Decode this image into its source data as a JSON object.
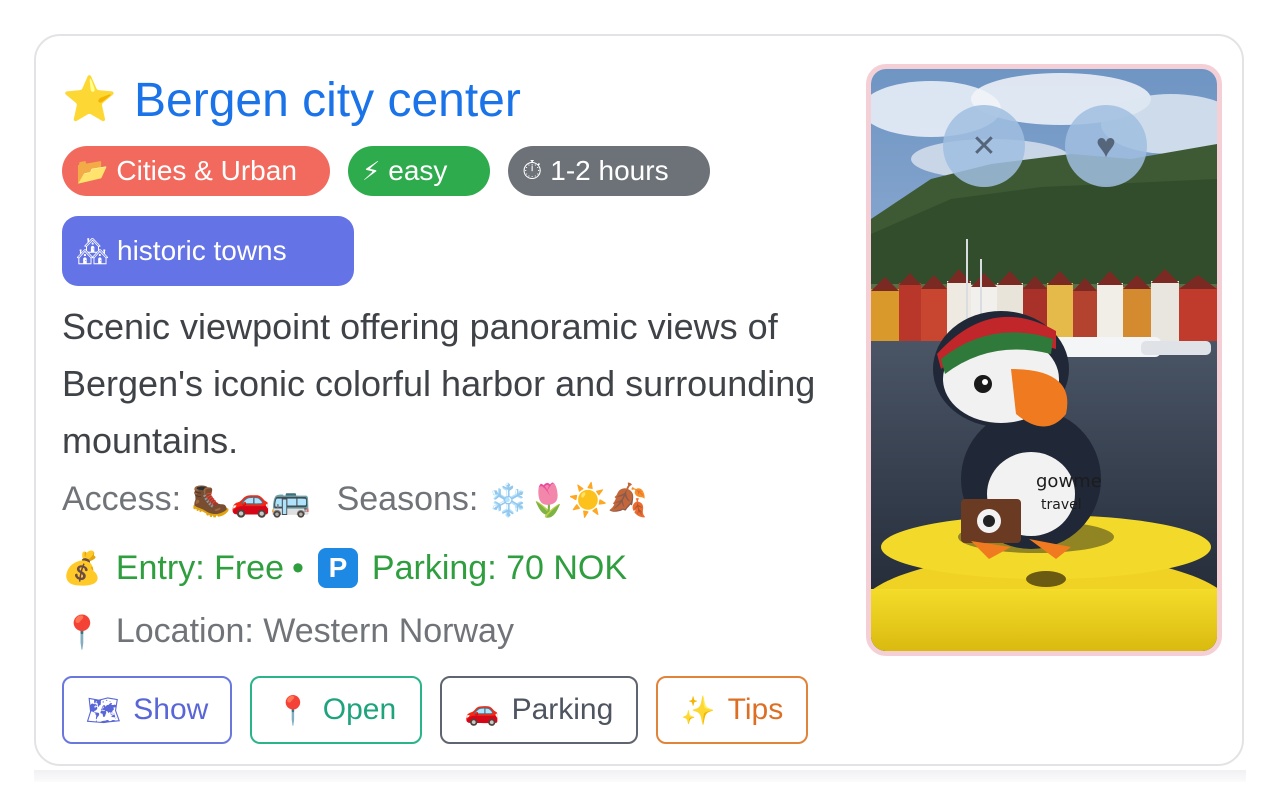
{
  "card": {
    "title_icon": "star-icon",
    "title": "Bergen city center",
    "badges": {
      "category": {
        "icon": "folder-icon",
        "label": "Cities & Urban",
        "color": "#f26a5e"
      },
      "difficulty": {
        "icon": "lightning-icon",
        "label": "easy",
        "color": "#2eab4c"
      },
      "duration": {
        "icon": "stopwatch-icon",
        "label": "1-2 hours",
        "color": "#6d7278"
      }
    },
    "tag": {
      "icon": "houses-icon",
      "label": "historic towns",
      "color": "#6473e6"
    },
    "description": "Scenic viewpoint offering panoramic views of Bergen's iconic colorful harbor and surrounding mountains.",
    "access_label": "Access:",
    "access_icons": [
      "hiking-boot-icon",
      "car-icon",
      "bus-icon"
    ],
    "seasons_label": "Seasons:",
    "season_icons": [
      "snowflake-icon",
      "tulip-icon",
      "sun-icon",
      "autumn-leaves-icon"
    ],
    "entry": "Entry: Free",
    "separator": "•",
    "parking_info": "Parking: 70 NOK",
    "location": "Location: Western Norway",
    "buttons": {
      "show": {
        "icon": "map-icon",
        "label": "Show"
      },
      "open": {
        "icon": "map-pin-icon",
        "label": "Open"
      },
      "parking": {
        "icon": "car-icon",
        "label": "Parking"
      },
      "tips": {
        "icon": "sparkles-icon",
        "label": "Tips"
      }
    },
    "photo": {
      "sign_text_1": "gowme",
      "sign_text_2": "travel"
    }
  }
}
